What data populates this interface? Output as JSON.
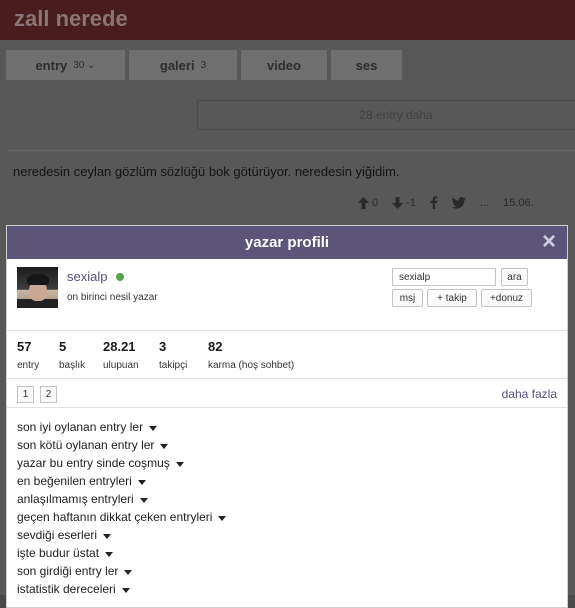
{
  "background": {
    "topic_title": "zall nerede",
    "tabs": [
      {
        "label": "entry",
        "count": "30 ⌄"
      },
      {
        "label": "galeri",
        "count": "3"
      },
      {
        "label": "video",
        "count": ""
      },
      {
        "label": "ses",
        "count": ""
      }
    ],
    "more_entries": "28 entry daha",
    "entry_text": "neredesin ceylan gözlüm sözlüğü bok götürüyor. neredesin yiğidim.",
    "actions": {
      "upvote_icon": "arrow-up-icon",
      "upvote_count": "0",
      "downvote_icon": "arrow-down-icon",
      "downvote_count": "-1",
      "share_facebook_icon": "facebook-icon",
      "share_twitter_icon": "twitter-icon",
      "more": "...",
      "date": "15.06."
    }
  },
  "modal": {
    "title": "yazar profili",
    "close_icon": "×",
    "user": {
      "username": "sexialp",
      "status": "online",
      "rank": "on birinci nesil yazar"
    },
    "search": {
      "value": "sexialp",
      "button": "ara"
    },
    "buttons": {
      "msj": "msj",
      "takip": "+ takip",
      "donuz": "+donuz"
    },
    "stats": [
      {
        "value": "57",
        "label": "entry"
      },
      {
        "value": "5",
        "label": "başlık"
      },
      {
        "value": "28.21",
        "label": "ulupuan"
      },
      {
        "value": "3",
        "label": "takipçi"
      },
      {
        "value": "82",
        "label": "karma (hoş sohbet)"
      }
    ],
    "pages": [
      "1",
      "2"
    ],
    "daha_fazla": "daha fazla",
    "sections": [
      "son iyi oylanan entry ler",
      "son kötü oylanan entry ler",
      "yazar bu entry sinde coşmuş",
      "en beğenilen entryleri",
      "anlaşılmamış entryleri",
      "geçen haftanın dikkat çeken entryleri",
      "sevdiği eserleri",
      "işte budur üstat",
      "son girdiği entry ler",
      "istatistik dereceleri"
    ],
    "colors": {
      "header": "#5d5579",
      "link": "#53507a",
      "online": "#53a548"
    }
  }
}
